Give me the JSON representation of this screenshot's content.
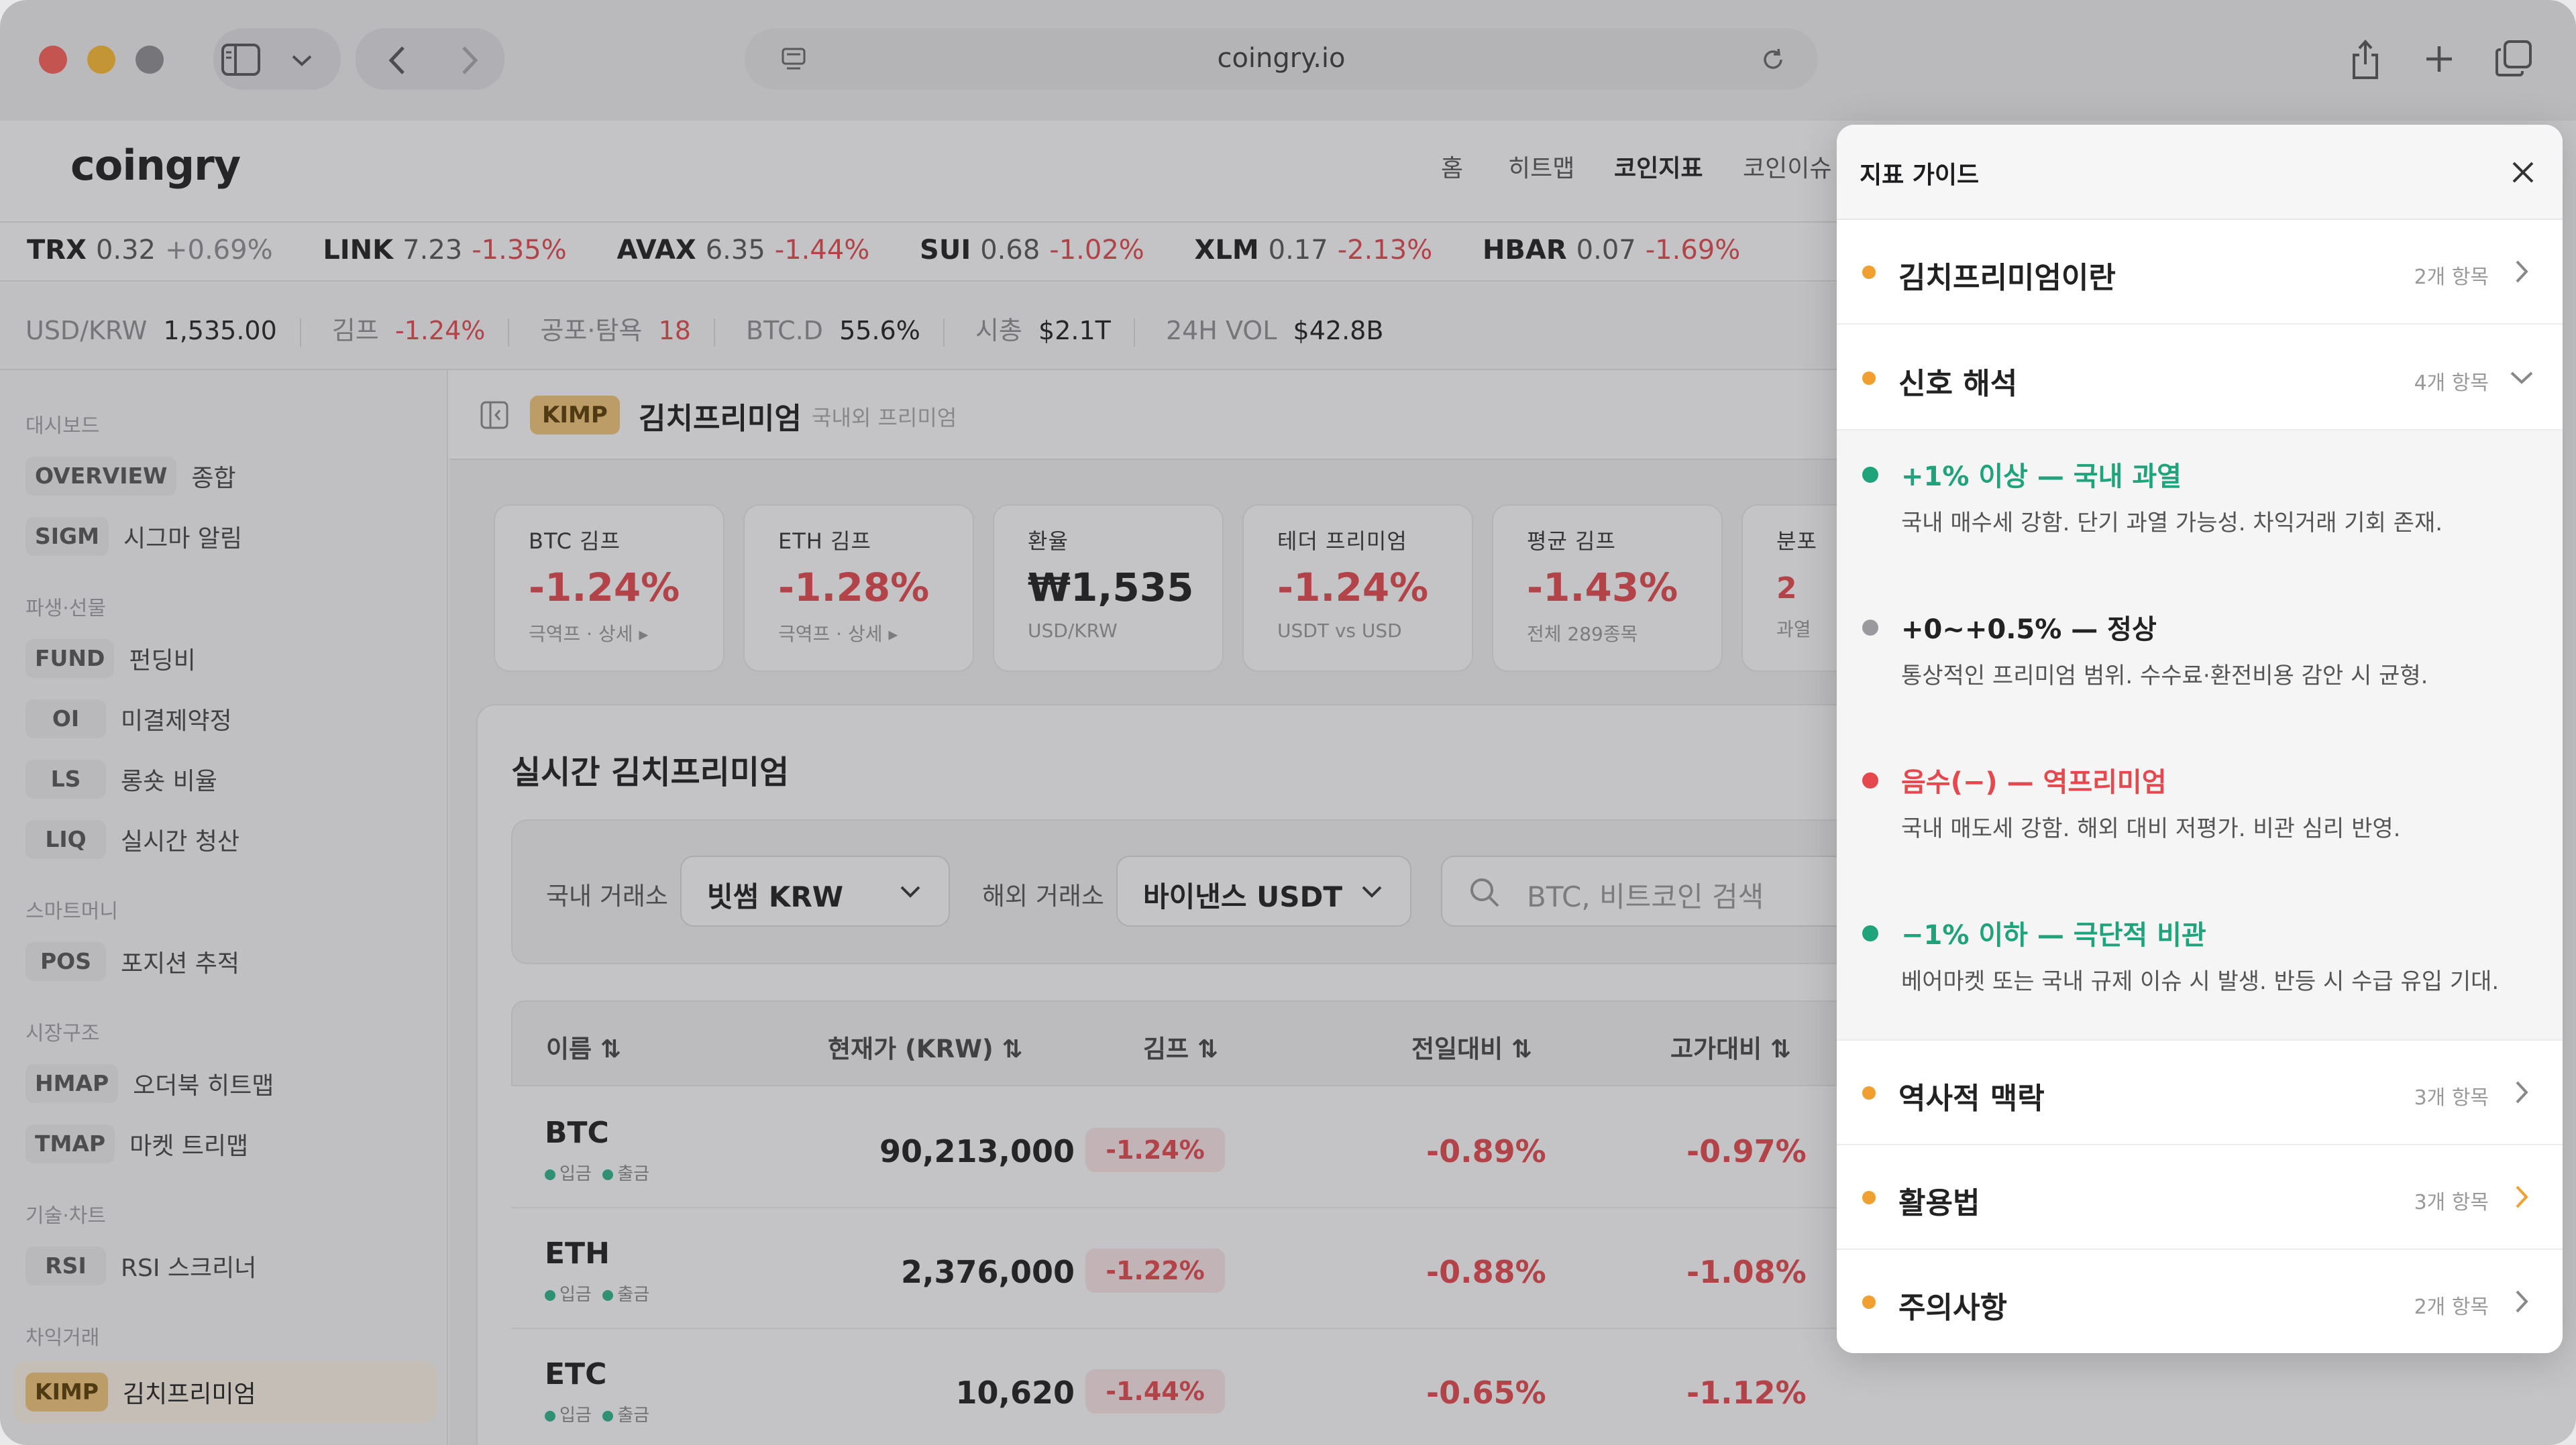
{
  "browser": {
    "url": "coingry.io"
  },
  "site": {
    "logo": "coingry",
    "nav": [
      "홈",
      "히트맵",
      "코인지표",
      "코인이슈"
    ]
  },
  "ticker": [
    {
      "sym": "TRX",
      "price": "0.32",
      "chg": "+0.69%",
      "up": true
    },
    {
      "sym": "LINK",
      "price": "7.23",
      "chg": "-1.35%",
      "up": false
    },
    {
      "sym": "AVAX",
      "price": "6.35",
      "chg": "-1.44%",
      "up": false
    },
    {
      "sym": "SUI",
      "price": "0.68",
      "chg": "-1.02%",
      "up": false
    },
    {
      "sym": "XLM",
      "price": "0.17",
      "chg": "-2.13%",
      "up": false
    },
    {
      "sym": "HBAR",
      "price": "0.07",
      "chg": "-1.69%",
      "up": false
    }
  ],
  "stats": {
    "usdkrw_label": "USD/KRW",
    "usdkrw": "1,535.00",
    "kimp_label": "김프",
    "kimp": "-1.24%",
    "fear_label": "공포·탐욕",
    "fear": "18",
    "btcd_label": "BTC.D",
    "btcd": "55.6%",
    "mcap_label": "시총",
    "mcap": "$2.1T",
    "vol_label": "24H VOL",
    "vol": "$42.8B"
  },
  "sidebar": {
    "sections": [
      "대시보드",
      "파생·선물",
      "스마트머니",
      "시장구조",
      "기술·차트",
      "차익거래"
    ],
    "items": [
      {
        "tag": "OVERVIEW",
        "label": "종합"
      },
      {
        "tag": "SIGM",
        "label": "시그마 알림"
      },
      {
        "tag": "FUND",
        "label": "펀딩비"
      },
      {
        "tag": "OI",
        "label": "미결제약정"
      },
      {
        "tag": "LS",
        "label": "롱숏 비율"
      },
      {
        "tag": "LIQ",
        "label": "실시간 청산"
      },
      {
        "tag": "POS",
        "label": "포지션 추적"
      },
      {
        "tag": "HMAP",
        "label": "오더북 히트맵"
      },
      {
        "tag": "TMAP",
        "label": "마켓 트리맵"
      },
      {
        "tag": "RSI",
        "label": "RSI 스크리너"
      },
      {
        "tag": "KIMP",
        "label": "김치프리미엄"
      }
    ]
  },
  "page": {
    "badge": "KIMP",
    "title": "김치프리미엄",
    "subtitle": "국내외 프리미엄"
  },
  "cards": [
    {
      "title": "BTC 김프",
      "value": "-1.24%",
      "sub": "극역프 · 상세 ▸"
    },
    {
      "title": "ETH 김프",
      "value": "-1.28%",
      "sub": "극역프 · 상세 ▸"
    },
    {
      "title": "환율",
      "value": "₩1,535",
      "sub": "USD/KRW"
    },
    {
      "title": "테더 프리미엄",
      "value": "-1.24%",
      "sub": "USDT vs USD"
    },
    {
      "title": "평균 김프",
      "value": "-1.43%",
      "sub": "전체 289종목"
    },
    {
      "title": "분포",
      "value": "2",
      "sub": "과열"
    }
  ],
  "realtime": {
    "title": "실시간 김치프리미엄",
    "domestic_label": "국내 거래소",
    "domestic": "빗썸 KRW",
    "foreign_label": "해외 거래소",
    "foreign": "바이낸스 USDT",
    "search_placeholder": "BTC, 비트코인 검색",
    "cols": [
      "이름",
      "현재가 (KRW)",
      "김프",
      "전일대비",
      "고가대비"
    ],
    "deposit": "입금",
    "withdraw": "출금",
    "rows": [
      {
        "sym": "BTC",
        "price": "90,213,000",
        "kimp": "-1.24%",
        "day": "-0.89%",
        "high": "-0.97%"
      },
      {
        "sym": "ETH",
        "price": "2,376,000",
        "kimp": "-1.22%",
        "day": "-0.88%",
        "high": "-1.08%"
      },
      {
        "sym": "ETC",
        "price": "10,620",
        "kimp": "-1.44%",
        "day": "-0.65%",
        "high": "-1.12%"
      }
    ]
  },
  "guide": {
    "title": "지표 가이드",
    "sections": [
      {
        "label": "김치프리미엄이란",
        "count": "2개 항목"
      },
      {
        "label": "신호 해석",
        "count": "4개 항목"
      },
      {
        "label": "역사적 맥락",
        "count": "3개 항목"
      },
      {
        "label": "활용법",
        "count": "3개 항목"
      },
      {
        "label": "주의사항",
        "count": "2개 항목"
      }
    ],
    "signals": [
      {
        "head": "+1% 이상 — 국내 과열",
        "desc": "국내 매수세 강함. 단기 과열 가능성. 차익거래 기회 존재.",
        "color": "#1fa37a"
      },
      {
        "head": "+0~+0.5% — 정상",
        "desc": "통상적인 프리미엄 범위. 수수료·환전비용 감안 시 균형.",
        "color": "#222222"
      },
      {
        "head": "음수(−) — 역프리미엄",
        "desc": "국내 매도세 강함. 해외 대비 저평가. 비관 심리 반영.",
        "color": "#e5484d"
      },
      {
        "head": "−1% 이하 — 극단적 비관",
        "desc": "베어마켓 또는 국내 규제 이슈 시 발생. 반등 시 수급 유입 기대.",
        "color": "#1fa37a"
      }
    ],
    "dot_colors": [
      "#1fa37a",
      "#9a9a9e",
      "#e5484d",
      "#1fa37a"
    ]
  }
}
